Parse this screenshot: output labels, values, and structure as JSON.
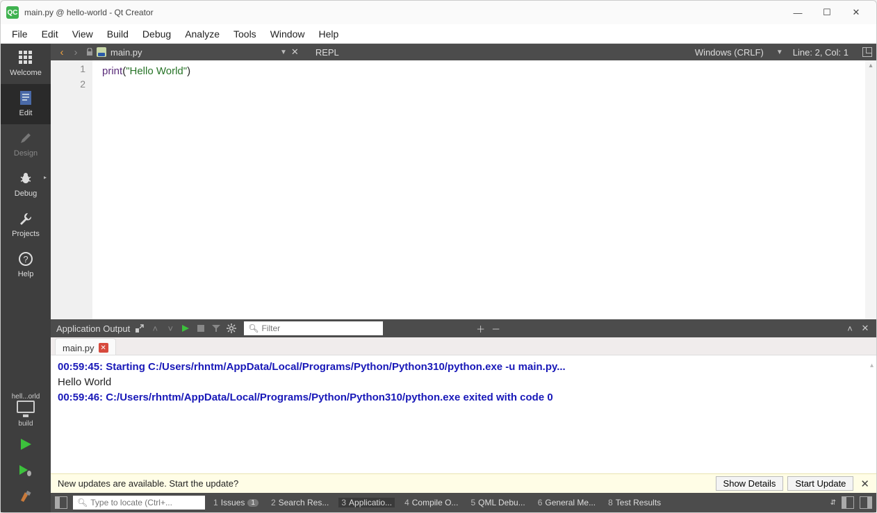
{
  "window": {
    "app_icon_text": "QC",
    "title": "main.py @ hello-world - Qt Creator"
  },
  "menubar": [
    "File",
    "Edit",
    "View",
    "Build",
    "Debug",
    "Analyze",
    "Tools",
    "Window",
    "Help"
  ],
  "sidebar": {
    "items": [
      {
        "id": "welcome",
        "label": "Welcome",
        "icon": "grid"
      },
      {
        "id": "edit",
        "label": "Edit",
        "icon": "doc",
        "active": true
      },
      {
        "id": "design",
        "label": "Design",
        "icon": "pencil",
        "disabled": true
      },
      {
        "id": "debug",
        "label": "Debug",
        "icon": "bug",
        "corner": "▸"
      },
      {
        "id": "projects",
        "label": "Projects",
        "icon": "wrench"
      },
      {
        "id": "help",
        "label": "Help",
        "icon": "question"
      }
    ],
    "kit_name": "hell...orld",
    "kit_type": "build"
  },
  "doc_toolbar": {
    "file_name": "main.py",
    "repl_label": "REPL",
    "encoding": "Windows (CRLF)",
    "cursor": "Line: 2, Col: 1"
  },
  "code": {
    "lines": [
      "1",
      "2"
    ],
    "tokens": {
      "func": "print",
      "open": "(",
      "str": "\"Hello World\"",
      "close": ")"
    }
  },
  "output_panel": {
    "title": "Application Output",
    "filter_placeholder": "Filter",
    "tab_label": "main.py",
    "lines": [
      {
        "kind": "ts",
        "text": "00:59:45: Starting C:/Users/rhntm/AppData/Local/Programs/Python/Python310/python.exe -u main.py..."
      },
      {
        "kind": "out",
        "text": "Hello World"
      },
      {
        "kind": "ts",
        "text": "00:59:46: C:/Users/rhntm/AppData/Local/Programs/Python/Python310/python.exe exited with code 0"
      }
    ]
  },
  "update_bar": {
    "message": "New updates are available. Start the update?",
    "show_details": "Show Details",
    "start_update": "Start Update"
  },
  "statusbar": {
    "locate_placeholder": "Type to locate (Ctrl+...",
    "tabs": [
      {
        "num": "1",
        "label": "Issues",
        "badge": "1"
      },
      {
        "num": "2",
        "label": "Search Res..."
      },
      {
        "num": "3",
        "label": "Applicatio...",
        "active": true
      },
      {
        "num": "4",
        "label": "Compile O..."
      },
      {
        "num": "5",
        "label": "QML Debu..."
      },
      {
        "num": "6",
        "label": "General Me..."
      },
      {
        "num": "8",
        "label": "Test Results"
      }
    ]
  }
}
